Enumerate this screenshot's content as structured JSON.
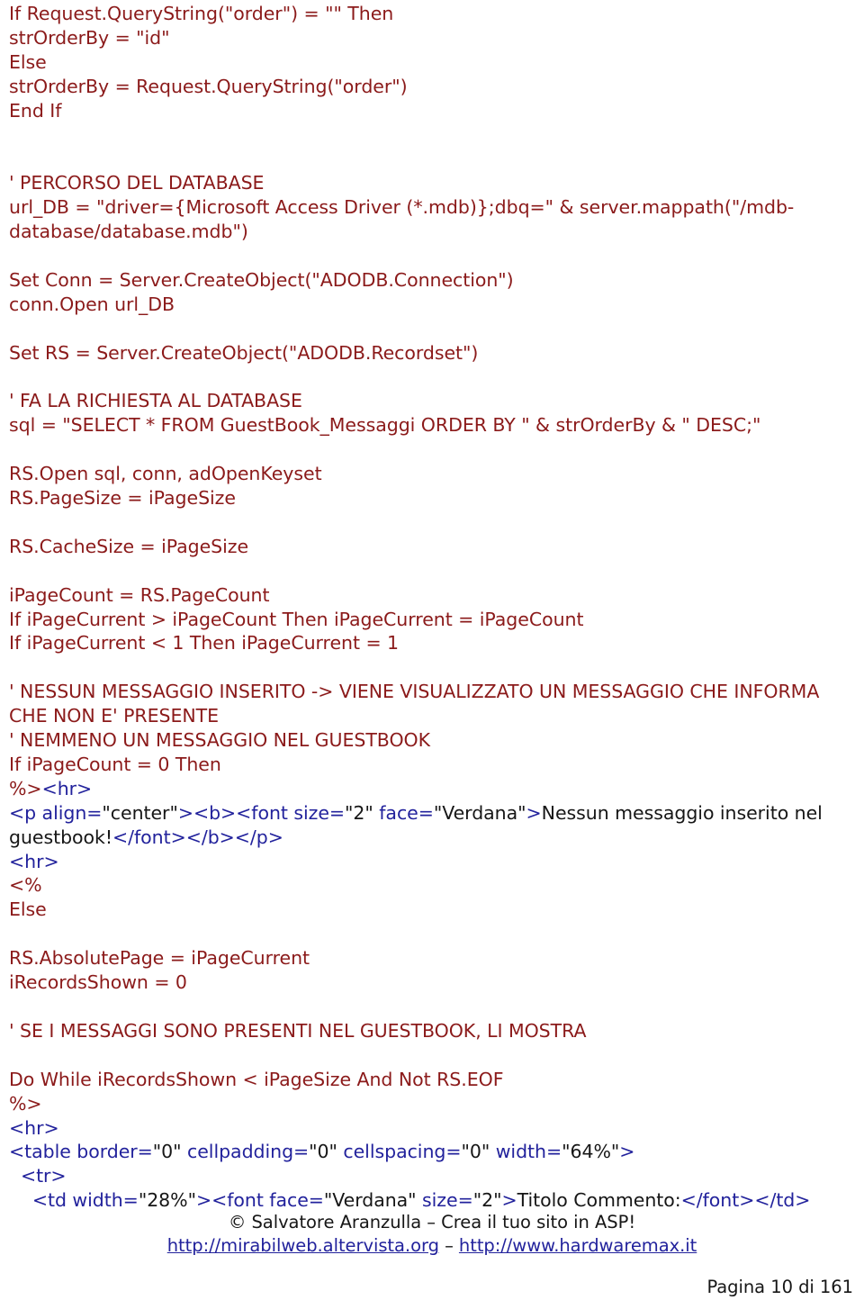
{
  "document": {
    "type": "pdf-page",
    "language": "it",
    "colors": {
      "asp_code": "#8B1A1A",
      "html_tag": "#22229C",
      "literal_text": "#161616",
      "link": "#22229C",
      "background": "#FFFFFF"
    }
  },
  "code": {
    "lines": [
      {
        "id": "l1",
        "segments": [
          {
            "style": "asp",
            "text": "If Request.QueryString(\"order\") = \"\" Then"
          }
        ]
      },
      {
        "id": "l2",
        "segments": [
          {
            "style": "asp",
            "text": "strOrderBy = \"id\""
          }
        ]
      },
      {
        "id": "l3",
        "segments": [
          {
            "style": "asp",
            "text": "Else"
          }
        ]
      },
      {
        "id": "l4",
        "segments": [
          {
            "style": "asp",
            "text": "strOrderBy = Request.QueryString(\"order\")"
          }
        ]
      },
      {
        "id": "l5",
        "segments": [
          {
            "style": "asp",
            "text": "End If"
          }
        ]
      },
      {
        "id": "l6",
        "blank": true
      },
      {
        "id": "l7",
        "blank": true
      },
      {
        "id": "l8",
        "segments": [
          {
            "style": "asp",
            "text": "' PERCORSO DEL DATABASE"
          }
        ]
      },
      {
        "id": "l9",
        "segments": [
          {
            "style": "asp",
            "text": "url_DB = \"driver={Microsoft Access Driver (*.mdb)};dbq=\" & server.mappath(\"/mdb-database/database.mdb\")"
          }
        ]
      },
      {
        "id": "l10",
        "blank": true
      },
      {
        "id": "l11",
        "segments": [
          {
            "style": "asp",
            "text": "Set Conn = Server.CreateObject(\"ADODB.Connection\")"
          }
        ]
      },
      {
        "id": "l12",
        "segments": [
          {
            "style": "asp",
            "text": "conn.Open url_DB"
          }
        ]
      },
      {
        "id": "l13",
        "blank": true
      },
      {
        "id": "l14",
        "segments": [
          {
            "style": "asp",
            "text": "Set RS = Server.CreateObject(\"ADODB.Recordset\")"
          }
        ]
      },
      {
        "id": "l15",
        "blank": true
      },
      {
        "id": "l16",
        "segments": [
          {
            "style": "asp",
            "text": "' FA LA RICHIESTA AL DATABASE"
          }
        ]
      },
      {
        "id": "l17",
        "segments": [
          {
            "style": "asp",
            "text": "sql = \"SELECT * FROM GuestBook_Messaggi ORDER BY \" & strOrderBy & \" DESC;\""
          }
        ]
      },
      {
        "id": "l18",
        "blank": true
      },
      {
        "id": "l19",
        "segments": [
          {
            "style": "asp",
            "text": "RS.Open sql, conn, adOpenKeyset"
          }
        ]
      },
      {
        "id": "l20",
        "segments": [
          {
            "style": "asp",
            "text": "RS.PageSize = iPageSize"
          }
        ]
      },
      {
        "id": "l21",
        "blank": true
      },
      {
        "id": "l22",
        "segments": [
          {
            "style": "asp",
            "text": "RS.CacheSize = iPageSize"
          }
        ]
      },
      {
        "id": "l23",
        "blank": true
      },
      {
        "id": "l24",
        "segments": [
          {
            "style": "asp",
            "text": "iPageCount = RS.PageCount"
          }
        ]
      },
      {
        "id": "l25",
        "segments": [
          {
            "style": "asp",
            "text": "If iPageCurrent > iPageCount Then iPageCurrent = iPageCount"
          }
        ]
      },
      {
        "id": "l26",
        "segments": [
          {
            "style": "asp",
            "text": "If iPageCurrent < 1 Then iPageCurrent = 1"
          }
        ]
      },
      {
        "id": "l27",
        "blank": true
      },
      {
        "id": "l28",
        "segments": [
          {
            "style": "asp",
            "text": "' NESSUN MESSAGGIO INSERITO -> VIENE VISUALIZZATO UN MESSAGGIO CHE INFORMA CHE NON E' PRESENTE"
          }
        ]
      },
      {
        "id": "l29",
        "segments": [
          {
            "style": "asp",
            "text": "' NEMMENO UN MESSAGGIO NEL GUESTBOOK"
          }
        ]
      },
      {
        "id": "l30",
        "segments": [
          {
            "style": "asp",
            "text": "If iPageCount = 0 Then"
          }
        ]
      },
      {
        "id": "l31",
        "segments": [
          {
            "style": "asp",
            "text": "%>"
          },
          {
            "style": "tag",
            "text": "<hr>"
          }
        ]
      },
      {
        "id": "l32",
        "segments": [
          {
            "style": "tag",
            "text": "<p align="
          },
          {
            "style": "lit",
            "text": "\"center\""
          },
          {
            "style": "tag",
            "text": "><b><font size="
          },
          {
            "style": "lit",
            "text": "\"2\""
          },
          {
            "style": "tag",
            "text": " face="
          },
          {
            "style": "lit",
            "text": "\"Verdana\""
          },
          {
            "style": "tag",
            "text": ">"
          },
          {
            "style": "lit",
            "text": "Nessun messaggio inserito nel guestbook!"
          },
          {
            "style": "tag",
            "text": "</font></b></p>"
          }
        ]
      },
      {
        "id": "l33",
        "segments": [
          {
            "style": "tag",
            "text": "<hr>"
          }
        ]
      },
      {
        "id": "l34",
        "segments": [
          {
            "style": "asp",
            "text": "<%"
          }
        ]
      },
      {
        "id": "l35",
        "segments": [
          {
            "style": "asp",
            "text": "Else"
          }
        ]
      },
      {
        "id": "l36",
        "blank": true
      },
      {
        "id": "l37",
        "segments": [
          {
            "style": "asp",
            "text": "RS.AbsolutePage = iPageCurrent"
          }
        ]
      },
      {
        "id": "l38",
        "segments": [
          {
            "style": "asp",
            "text": "iRecordsShown = 0"
          }
        ]
      },
      {
        "id": "l39",
        "blank": true
      },
      {
        "id": "l40",
        "segments": [
          {
            "style": "asp",
            "text": "' SE I MESSAGGI SONO PRESENTI NEL GUESTBOOK, LI MOSTRA"
          }
        ]
      },
      {
        "id": "l41",
        "blank": true
      },
      {
        "id": "l42",
        "segments": [
          {
            "style": "asp",
            "text": "Do While iRecordsShown < iPageSize And Not RS.EOF"
          }
        ]
      },
      {
        "id": "l43",
        "segments": [
          {
            "style": "asp",
            "text": "%>"
          }
        ]
      },
      {
        "id": "l44",
        "segments": [
          {
            "style": "tag",
            "text": "<hr>"
          }
        ]
      },
      {
        "id": "l45",
        "segments": [
          {
            "style": "tag",
            "text": "<table border="
          },
          {
            "style": "lit",
            "text": "\"0\""
          },
          {
            "style": "tag",
            "text": " cellpadding="
          },
          {
            "style": "lit",
            "text": "\"0\""
          },
          {
            "style": "tag",
            "text": " cellspacing="
          },
          {
            "style": "lit",
            "text": "\"0\""
          },
          {
            "style": "tag",
            "text": " width="
          },
          {
            "style": "lit",
            "text": "\"64%\""
          },
          {
            "style": "tag",
            "text": ">"
          }
        ]
      },
      {
        "id": "l46",
        "segments": [
          {
            "style": "tag",
            "text": "  <tr>"
          }
        ]
      },
      {
        "id": "l47",
        "segments": [
          {
            "style": "tag",
            "text": "    <td width="
          },
          {
            "style": "lit",
            "text": "\"28%\""
          },
          {
            "style": "tag",
            "text": "><font face="
          },
          {
            "style": "lit",
            "text": "\"Verdana\""
          },
          {
            "style": "tag",
            "text": " size="
          },
          {
            "style": "lit",
            "text": "\"2\""
          },
          {
            "style": "tag",
            "text": ">"
          },
          {
            "style": "lit",
            "text": "Titolo Commento:"
          },
          {
            "style": "tag",
            "text": "</font></td>"
          }
        ]
      }
    ]
  },
  "footer": {
    "copyright": "© Salvatore Aranzulla – Crea il tuo sito in ASP!",
    "link1": "http://mirabilweb.altervista.org",
    "separator": " – ",
    "link2": "http://www.hardwaremax.it",
    "page_number": "Pagina 10 di 161"
  }
}
